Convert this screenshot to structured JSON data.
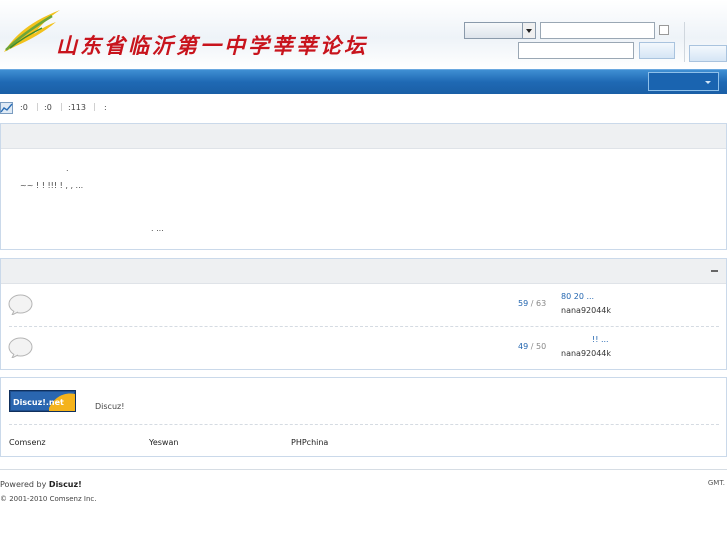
{
  "header": {
    "site_title": "山东省临沂第一中学莘莘论坛"
  },
  "stats": {
    "items": [
      {
        "label": ":",
        "value": "0"
      },
      {
        "label": ":",
        "value": "0"
      },
      {
        "label": ":",
        "value": "113"
      },
      {
        "label": ":",
        "value": ""
      }
    ],
    "separator": "|"
  },
  "announcement": {
    "line1": ".",
    "line2": "~~  !            !               !!!                !        ,                 ,        ...",
    "line3": ".                      ..."
  },
  "forums": [
    {
      "topics": "59",
      "posts": "63",
      "count_sep": "/",
      "last_title": "80     20     ...",
      "last_user": "nana92044k"
    },
    {
      "topics": "49",
      "posts": "50",
      "count_sep": "/",
      "last_title": "!! ...",
      "last_user": "nana92044k"
    }
  ],
  "links": {
    "logo_text": "Discuz!.net",
    "description": "Discuz!",
    "items": [
      "Comsenz",
      "Yeswan",
      "PHPchina"
    ]
  },
  "footer": {
    "powered_prefix": "Powered by",
    "powered_brand": "Discuz!",
    "copyright": "© 2001-2010 Comsenz Inc.",
    "timezone": "GMT."
  },
  "colors": {
    "nav_blue": "#1f69b4",
    "link_blue": "#2366b0",
    "logo_red": "#c8141d"
  }
}
